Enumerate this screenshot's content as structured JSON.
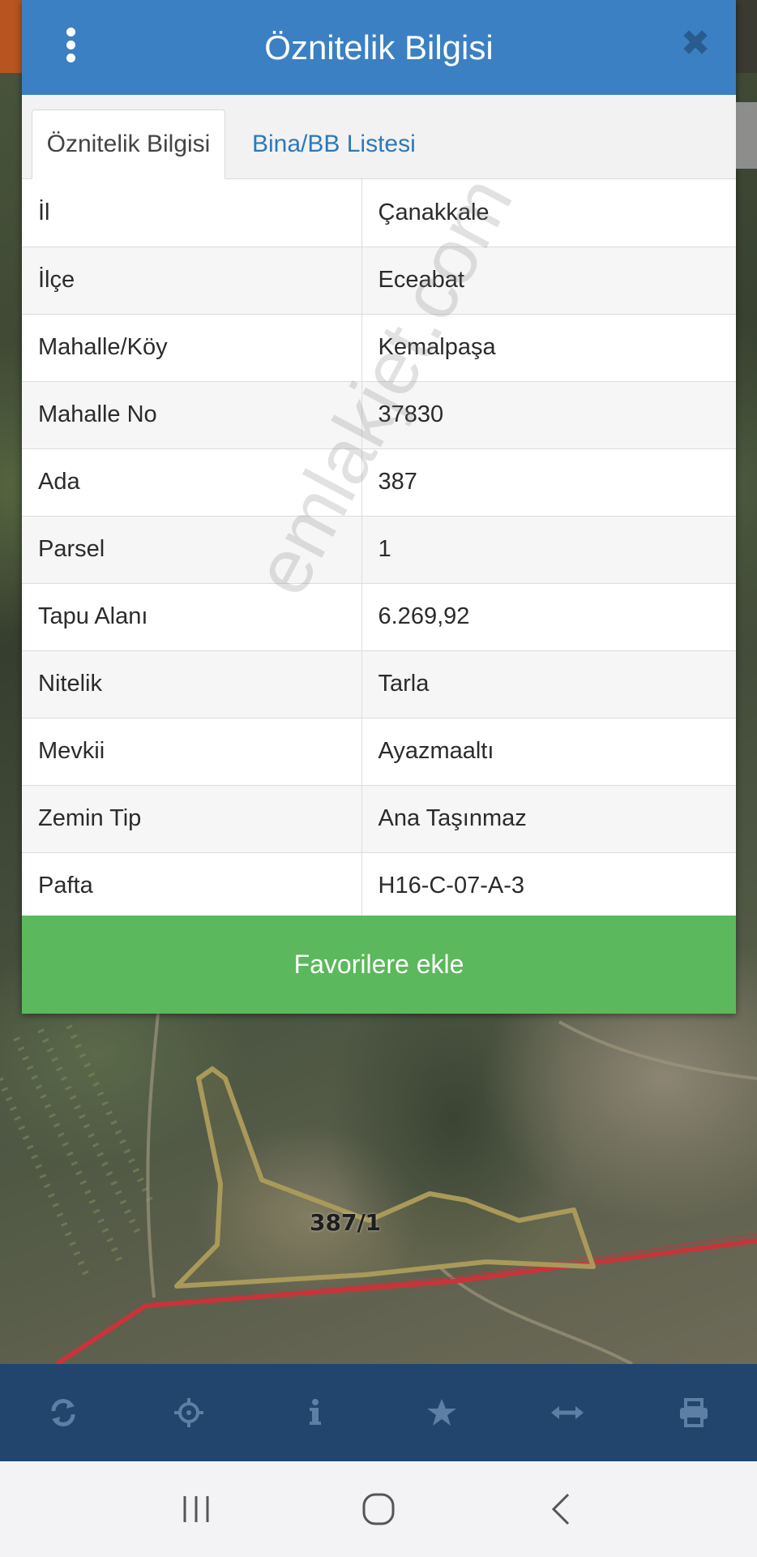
{
  "dialog": {
    "title": "Öznitelik Bilgisi",
    "tabs": [
      {
        "label": "Öznitelik Bilgisi",
        "active": true
      },
      {
        "label": "Bina/BB Listesi",
        "active": false
      }
    ],
    "rows": [
      {
        "key": "İl",
        "value": "Çanakkale"
      },
      {
        "key": "İlçe",
        "value": "Eceabat"
      },
      {
        "key": "Mahalle/Köy",
        "value": "Kemalpaşa"
      },
      {
        "key": "Mahalle No",
        "value": "37830"
      },
      {
        "key": "Ada",
        "value": "387"
      },
      {
        "key": "Parsel",
        "value": "1"
      },
      {
        "key": "Tapu Alanı",
        "value": "6.269,92"
      },
      {
        "key": "Nitelik",
        "value": "Tarla"
      },
      {
        "key": "Mevkii",
        "value": "Ayazmaaltı"
      },
      {
        "key": "Zemin Tip",
        "value": "Ana Taşınmaz"
      },
      {
        "key": "Pafta",
        "value": "H16-C-07-A-3"
      }
    ],
    "favorite_button": "Favorilere ekle",
    "watermark": "emlakjet.com"
  },
  "map": {
    "parcel_label": "387/1"
  },
  "toolbar": {
    "icons": [
      "refresh-icon",
      "crosshair-icon",
      "info-icon",
      "star-icon",
      "measure-icon",
      "print-icon"
    ]
  },
  "navbar": {
    "icons": [
      "recent-apps-icon",
      "home-icon",
      "back-icon"
    ]
  },
  "colors": {
    "header": "#3b80c2",
    "tab_link": "#2e78b8",
    "favorite_button": "#5cb85c",
    "toolbar": "#21456d",
    "parcel_outline": "#a99a5a",
    "road": "#c8343a"
  }
}
